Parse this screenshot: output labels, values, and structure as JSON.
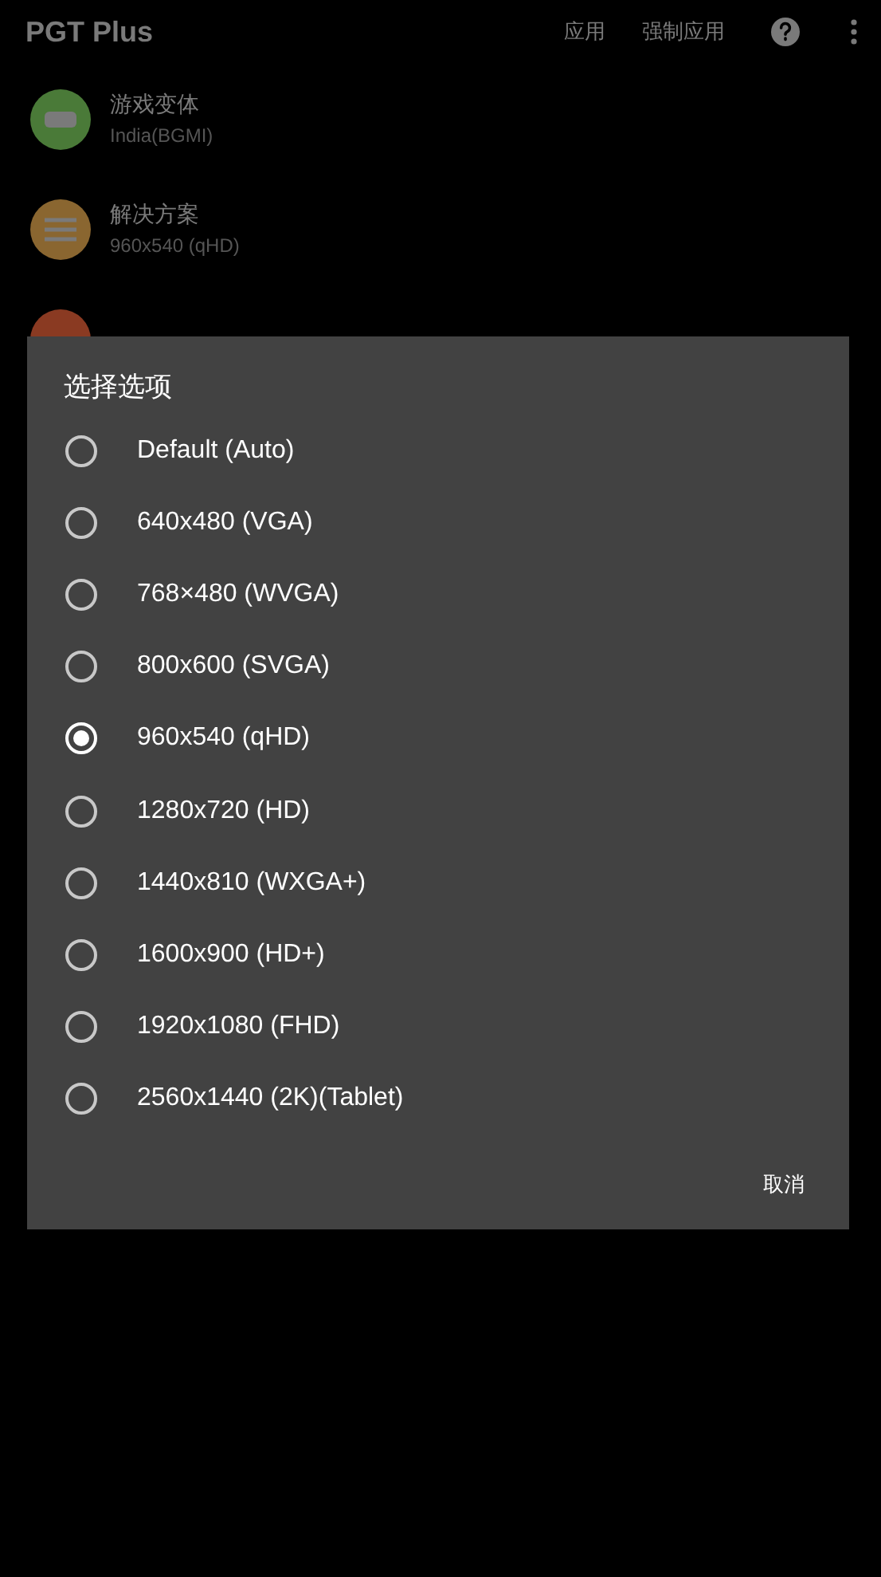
{
  "app_bar": {
    "title": "PGT Plus",
    "actions": [
      "应用",
      "强制应用"
    ]
  },
  "settings": [
    {
      "kind": "gamepad",
      "title": "游戏变体",
      "subtitle": "India(BGMI)",
      "color": "#4a7a38"
    },
    {
      "kind": "sliders",
      "title": "解决方案",
      "subtitle": "960x540 (qHD)",
      "color": "#8a6630"
    },
    {
      "kind": "graphics",
      "color": "#8a3a22"
    }
  ],
  "dialog": {
    "title": "选择选项",
    "options": [
      {
        "label": "Default (Auto)",
        "selected": false
      },
      {
        "label": "640x480 (VGA)",
        "selected": false
      },
      {
        "label": "768×480 (WVGA)",
        "selected": false
      },
      {
        "label": "800x600 (SVGA)",
        "selected": false
      },
      {
        "label": "960x540 (qHD)",
        "selected": true
      },
      {
        "label": "1280x720 (HD)",
        "selected": false
      },
      {
        "label": "1440x810 (WXGA+)",
        "selected": false
      },
      {
        "label": "1600x900 (HD+)",
        "selected": false
      },
      {
        "label": "1920x1080 (FHD)",
        "selected": false
      },
      {
        "label": "2560x1440 (2K)(Tablet)",
        "selected": false
      }
    ],
    "cancel": "取消"
  }
}
